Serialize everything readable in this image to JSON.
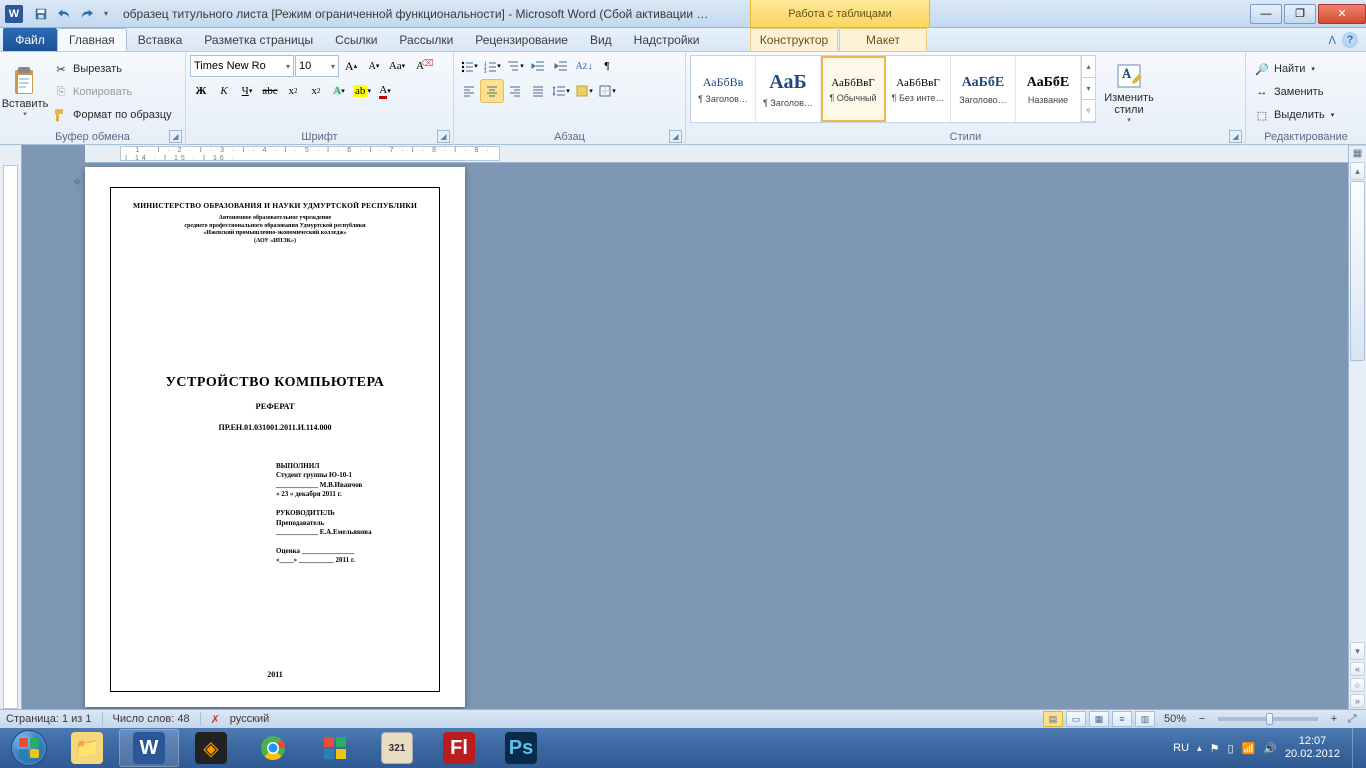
{
  "title": "образец титульного листа [Режим ограниченной функциональности]  -  Microsoft Word (Сбой активации …",
  "tableTools": "Работа с таблицами",
  "tabs": {
    "file": "Файл",
    "items": [
      "Главная",
      "Вставка",
      "Разметка страницы",
      "Ссылки",
      "Рассылки",
      "Рецензирование",
      "Вид",
      "Надстройки"
    ],
    "context": [
      "Конструктор",
      "Макет"
    ],
    "activeIndex": 0
  },
  "ribbon": {
    "clipboard": {
      "label": "Буфер обмена",
      "paste": "Вставить",
      "cut": "Вырезать",
      "copy": "Копировать",
      "format": "Формат по образцу"
    },
    "font": {
      "label": "Шрифт",
      "name": "Times New Ro",
      "size": "10"
    },
    "paragraph": {
      "label": "Абзац"
    },
    "styles": {
      "label": "Стили",
      "change": "Изменить стили",
      "items": [
        {
          "preview": "АаБбВв",
          "name": "¶ Заголов…",
          "size": "12px",
          "color": "#1f497d"
        },
        {
          "preview": "АаБ",
          "name": "¶ Заголов…",
          "size": "20px",
          "bold": true,
          "color": "#1f497d"
        },
        {
          "preview": "АаБбВвГ",
          "name": "¶ Обычный",
          "size": "11px",
          "sel": true,
          "color": "#000"
        },
        {
          "preview": "АаБбВвГ",
          "name": "¶ Без инте…",
          "size": "11px",
          "color": "#000"
        },
        {
          "preview": "АаБбЕ",
          "name": "Заголово…",
          "size": "14px",
          "bold": true,
          "color": "#1f497d"
        },
        {
          "preview": "АаБбЕ",
          "name": "Название",
          "size": "14px",
          "bold": true,
          "color": "#000"
        }
      ]
    },
    "editing": {
      "label": "Редактирование",
      "find": "Найти",
      "replace": "Заменить",
      "select": "Выделить"
    }
  },
  "hruler_ticks": "· 1 · Ⅰ · 2 · Ⅰ · 3 · Ⅰ · 4 · Ⅰ · 5 · Ⅰ · 6 · Ⅰ · 7 · Ⅰ · 8 · Ⅰ · 9 · Ⅰ 14 · Ⅰ 15 · Ⅰ 16 ·",
  "document": {
    "ministry": "МИНИСТЕРСТВО ОБРАЗОВАНИЯ И НАУКИ УДМУРТСКОЙ РЕСПУБЛИКИ",
    "inst1": "Автономное образовательное учреждение",
    "inst2": "среднего профессионального образования Удмуртской республики",
    "inst3": "«Ижевский промышленно-экономический   колледж»",
    "inst4": "(АОУ «ИПЭК»)",
    "title": "УСТРОЙСТВО  КОМПЬЮТЕРА",
    "subtitle": "РЕФЕРАТ",
    "code": "ПР.ЕН.01.031001.2011.И.114.000",
    "exec_h": "ВЫПОЛНИЛ",
    "exec_1": "Студент группы Ю-10-1",
    "exec_2": "____________ М.В.Иванчов",
    "exec_3": "« 23 »  декабря 2011 г.",
    "sup_h": "РУКОВОДИТЕЛЬ",
    "sup_1": "Преподаватель",
    "sup_2": "____________ Е.А.Емельянова",
    "grade": "Оценка _______________",
    "grade_date": "«____»  __________  2011 г.",
    "year": "2011"
  },
  "status": {
    "page": "Страница: 1 из 1",
    "words": "Число слов: 48",
    "lang": "русский",
    "zoom": "50%"
  },
  "tray": {
    "lang": "RU",
    "time": "12:07",
    "date": "20.02.2012"
  }
}
